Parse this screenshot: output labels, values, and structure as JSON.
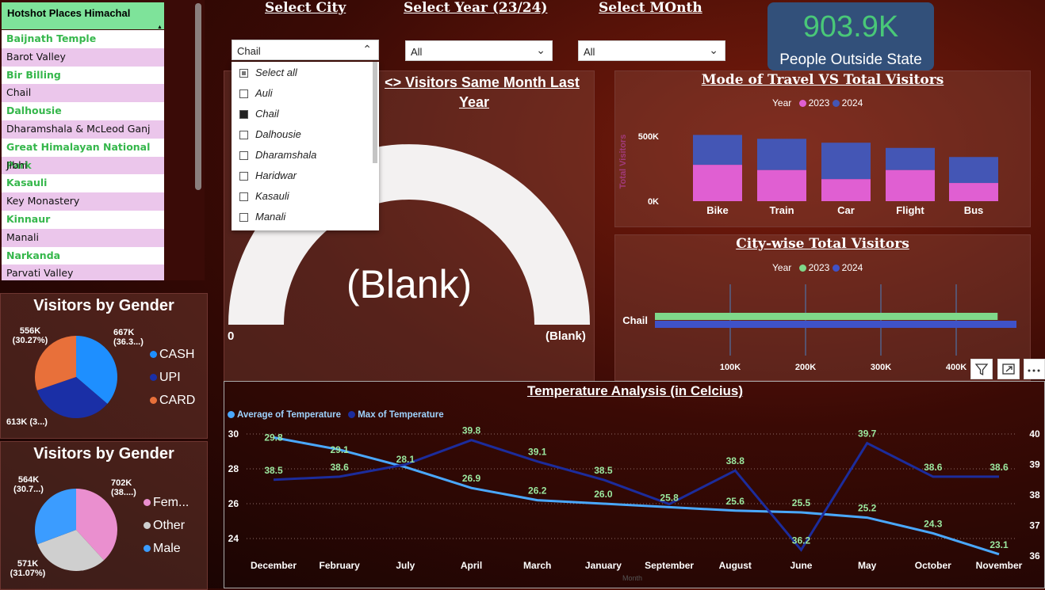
{
  "places": {
    "header": "Hotshot Places Himachal",
    "items": [
      "Baijnath Temple",
      "Barot Valley",
      "Bir Billing",
      "Chail",
      "Dalhousie",
      "Dharamshala & McLeod Ganj",
      "Great Himalayan National Park",
      "Jibhi",
      "Kasauli",
      "Key Monastery",
      "Kinnaur",
      "Manali",
      "Narkanda",
      "Parvati Valley"
    ]
  },
  "filters": {
    "city": {
      "title": "Select City",
      "value": "Chail"
    },
    "year": {
      "title": "Select Year (23/24)",
      "value": "All"
    },
    "month": {
      "title": "Select MOnth",
      "value": "All"
    }
  },
  "city_options": [
    {
      "label": "Select all",
      "state": "partial"
    },
    {
      "label": "Auli",
      "state": "unchecked"
    },
    {
      "label": "Chail",
      "state": "checked"
    },
    {
      "label": "Dalhousie",
      "state": "unchecked"
    },
    {
      "label": "Dharamshala",
      "state": "unchecked"
    },
    {
      "label": "Haridwar",
      "state": "unchecked"
    },
    {
      "label": "Kasauli",
      "state": "unchecked"
    },
    {
      "label": "Manali",
      "state": "unchecked"
    }
  ],
  "kpi": {
    "value": "903.9K",
    "label": "People Outside State"
  },
  "gauge": {
    "title_line1": "<> Visitors Same Month Last",
    "title_line2": "Year",
    "center": "(Blank)",
    "min": "0",
    "max": "(Blank)"
  },
  "gender_pie_1": {
    "title": "Visitors by Gender",
    "labels": [
      {
        "text1": "556K",
        "text2": "(30.27%)"
      },
      {
        "text1": "667K",
        "text2": "(36.3...)"
      },
      {
        "text1": "613K (3...)",
        "text2": ""
      }
    ],
    "legend": [
      {
        "name": "CASH",
        "color": "#1e8fff"
      },
      {
        "name": "UPI",
        "color": "#1a2fa6"
      },
      {
        "name": "CARD",
        "color": "#e8703a"
      }
    ]
  },
  "gender_pie_2": {
    "title": "Visitors by Gender",
    "labels": [
      {
        "text1": "564K",
        "text2": "(30.7...)"
      },
      {
        "text1": "702K",
        "text2": "(38....)"
      },
      {
        "text1": "571K",
        "text2": "(31.07%)"
      }
    ],
    "legend": [
      {
        "name": "Fem...",
        "color": "#ea8fcf"
      },
      {
        "name": "Other",
        "color": "#cfcfcf"
      },
      {
        "name": "Male",
        "color": "#3b9cff"
      }
    ]
  },
  "travel_chart": {
    "title": "Mode of Travel VS Total Visitors",
    "legend_title": "Year",
    "ylabel": "Total Visitors",
    "ticks": [
      "500K",
      "0K"
    ]
  },
  "city_chart": {
    "title": "City-wise Total Visitors",
    "legend_title": "Year"
  },
  "temp_chart": {
    "title": "Temperature Analysis (in Celcius)",
    "xlabel": "Month"
  },
  "visual_icons": {
    "filter": "filter-icon",
    "focus": "focus-mode-icon",
    "more": "more-options-icon"
  },
  "chart_data": [
    {
      "type": "bar",
      "title": "Mode of Travel VS Total Visitors",
      "categories": [
        "Bike",
        "Train",
        "Car",
        "Flight",
        "Bus"
      ],
      "series": [
        {
          "name": "2023",
          "color": "#e05fd2",
          "values": [
            280000,
            240000,
            170000,
            240000,
            140000
          ]
        },
        {
          "name": "2024",
          "color": "#4456b5",
          "values": [
            230000,
            240000,
            280000,
            170000,
            200000
          ]
        }
      ],
      "ylabel": "Total Visitors",
      "ylim": [
        0,
        600000
      ],
      "y_ticks": [
        "0K",
        "500K"
      ],
      "stacked": true,
      "legend": "top"
    },
    {
      "type": "bar",
      "orientation": "horizontal",
      "title": "City-wise Total Visitors",
      "categories": [
        "Chail"
      ],
      "series": [
        {
          "name": "2023",
          "color": "#7fd88a",
          "values": [
            455000
          ]
        },
        {
          "name": "2024",
          "color": "#3f52c8",
          "values": [
            480000
          ]
        }
      ],
      "xlim": [
        0,
        430000
      ],
      "x_ticks": [
        "100K",
        "200K",
        "300K",
        "400K"
      ],
      "legend": "top"
    },
    {
      "type": "line",
      "title": "Temperature Analysis (in Celcius)",
      "xlabel": "Month",
      "x": [
        "December",
        "February",
        "July",
        "April",
        "March",
        "January",
        "September",
        "August",
        "June",
        "May",
        "October",
        "November"
      ],
      "series": [
        {
          "name": "Average of Temperature",
          "color": "#4aa8ff",
          "axis": "left",
          "values": [
            29.8,
            29.1,
            28.1,
            26.9,
            26.2,
            26.0,
            25.8,
            25.6,
            25.5,
            25.2,
            24.3,
            23.1
          ]
        },
        {
          "name": "Max of Temperature",
          "color": "#1c2c9c",
          "axis": "right",
          "values": [
            38.5,
            38.6,
            39.0,
            39.8,
            39.1,
            38.5,
            37.7,
            38.8,
            36.2,
            39.7,
            38.6,
            38.6
          ]
        }
      ],
      "y_left": {
        "range": [
          23,
          30.5
        ],
        "ticks": [
          24,
          26,
          28,
          30
        ]
      },
      "y_right": {
        "range": [
          35.8,
          40.2
        ],
        "ticks": [
          36,
          37,
          38,
          39,
          40
        ]
      },
      "data_labels": {
        "Average of Temperature": [
          "29.8",
          "29.1",
          "28.1",
          "26.9",
          "26.2",
          "26.0",
          "25.8",
          "25.6",
          "25.5",
          "25.2",
          "24.3",
          "23.1"
        ],
        "Max of Temperature": [
          "38.5",
          "38.6",
          "",
          "39.8",
          "39.1",
          "38.5",
          "",
          "38.8",
          "36.2",
          "39.7",
          "38.6",
          "38.6"
        ]
      },
      "legend": "top-left"
    }
  ]
}
